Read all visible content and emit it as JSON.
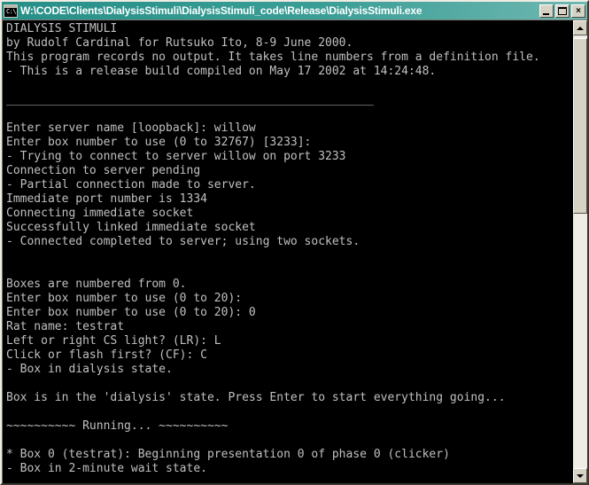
{
  "window": {
    "title": "W:\\CODE\\Clients\\DialysisStimuli\\DialysisStimuli_code\\Release\\DialysisStimuli.exe",
    "icon": "console-prompt-icon",
    "icon_glyph": "C:\\",
    "title_bar_color": "#2f8c86",
    "face_color": "#d6d3c4",
    "console_bg": "#000000",
    "console_fg": "#c0c0c0",
    "buttons": {
      "minimize_label": "_",
      "maximize_label": "□",
      "close_label": "×"
    }
  },
  "scrollbar": {
    "up_arrow": "scroll-up-arrow-icon",
    "down_arrow": "scroll-down-arrow-icon",
    "thumb": "scroll-thumb",
    "position_percent": 0
  },
  "console": {
    "lines": [
      "DIALYSIS STIMULI",
      "by Rudolf Cardinal for Rutsuko Ito, 8-9 June 2000.",
      "This program records no output. It takes line numbers from a definition file.",
      "- This is a release build compiled on May 17 2002 at 14:24:48.",
      "",
      "_____________________________________________________",
      "",
      "Enter server name [loopback]: willow",
      "Enter box number to use (0 to 32767) [3233]:",
      "- Trying to connect to server willow on port 3233",
      "Connection to server pending",
      "- Partial connection made to server.",
      "Immediate port number is 1334",
      "Connecting immediate socket",
      "Successfully linked immediate socket",
      "- Connected completed to server; using two sockets.",
      "",
      "",
      "Boxes are numbered from 0.",
      "Enter box number to use (0 to 20):",
      "Enter box number to use (0 to 20): 0",
      "Rat name: testrat",
      "Left or right CS light? (LR): L",
      "Click or flash first? (CF): C",
      "- Box in dialysis state.",
      "",
      "Box is in the 'dialysis' state. Press Enter to start everything going...",
      "",
      "~~~~~~~~~~ Running... ~~~~~~~~~~",
      "",
      "* Box 0 (testrat): Beginning presentation 0 of phase 0 (clicker)",
      "- Box in 2-minute wait state."
    ]
  }
}
